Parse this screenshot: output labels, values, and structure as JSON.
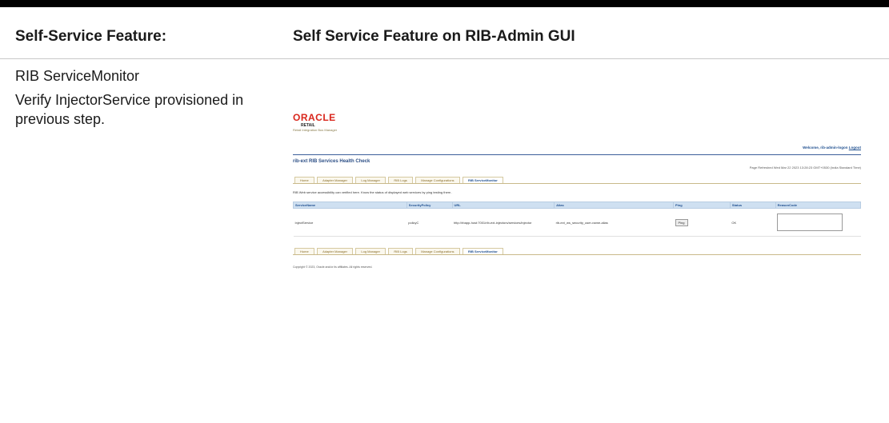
{
  "header": {
    "left_label": "Self-Service Feature:",
    "right_label": "Self Service Feature on RIB-Admin GUI"
  },
  "left": {
    "feature_name": "RIB ServiceMonitor",
    "instruction": "Verify InjectorService provisioned in previous step."
  },
  "screenshot": {
    "logo_text": "ORACLE",
    "logo_sub1": "RETAIL",
    "logo_sub2": "Retail Integration Bus Manager",
    "welcome_text": "Welcome, rib-admin-logon",
    "logout_text": "Logout",
    "page_title": "rib-ext RIB Services Health Check",
    "refresh_text": "Page Refreshed Wed Mar 22 2023 13:28:23 GMT+0530 (India Standard Time)",
    "tabs": [
      "Home",
      "Adapter Manager",
      "Log Manager",
      "RIB Logs",
      "Manage Configurations",
      "RIB ServiceMonitor"
    ],
    "active_tab": "RIB ServiceMonitor",
    "description": "RIB Web service accessibility can verified here. Know the status of displayed web services by ping testing them .",
    "columns": [
      "ServiceName",
      "SecurityPolicy",
      "URL",
      "Alias",
      "Ping",
      "Status",
      "ReasonCode"
    ],
    "row": {
      "service": "InjectService",
      "policy": "policyC",
      "url": "http://rbapp-host:7001/rib-ext-injectors/services/injector",
      "alias": "rib-ext_ws_security_user-name-alias",
      "ping": "Ping",
      "status": "OK",
      "reason": ""
    },
    "copyright": "Copyright © 2023, Oracle and/or its affiliates. All rights reserved."
  }
}
